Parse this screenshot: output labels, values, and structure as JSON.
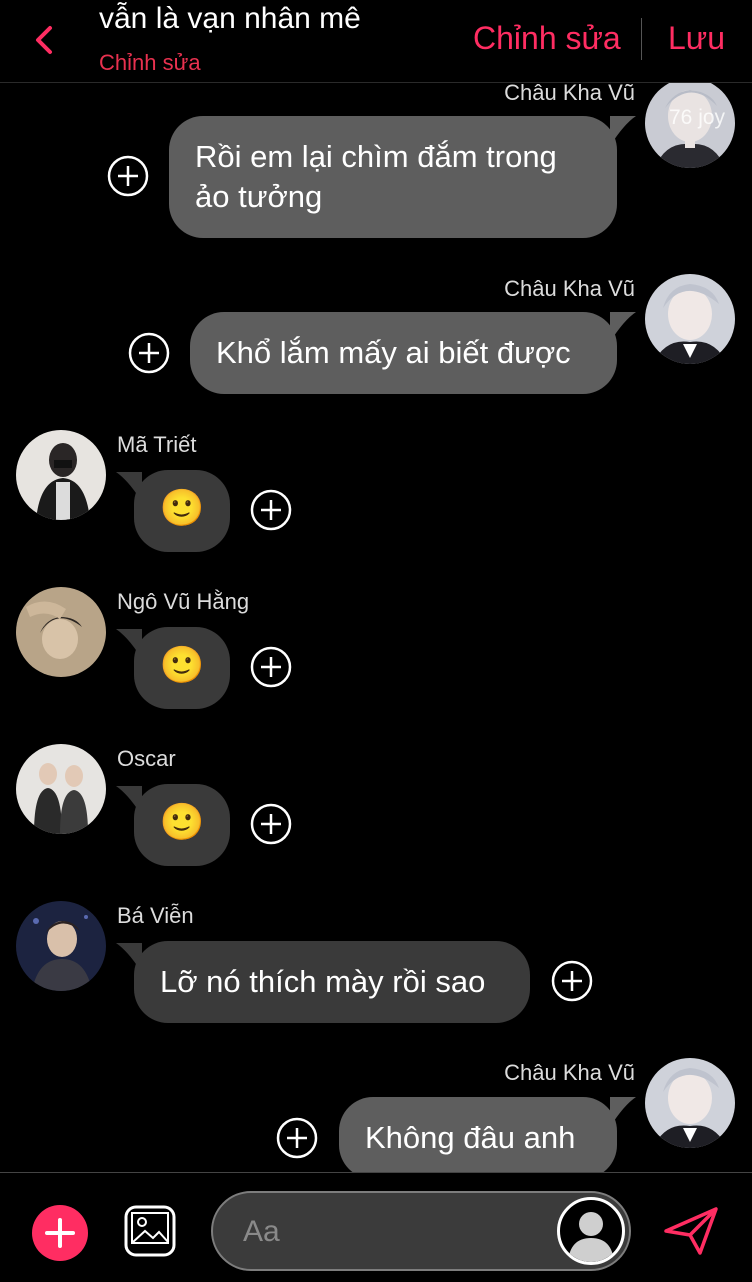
{
  "header": {
    "title": "vẫn là vạn nhân mê",
    "subtitle": "Chỉnh sửa",
    "edit_label": "Chỉnh sửa",
    "save_label": "Lưu"
  },
  "messages": [
    {
      "sender": "Châu Kha Vũ",
      "text": "Rồi em lại chìm đắm trong ảo tưởng",
      "line1": "Rồi em lại chìm đắm trong",
      "line2": "ảo tưởng",
      "avatar_watermark": "76 joy"
    },
    {
      "sender": "Châu Kha Vũ",
      "text": "Khổ lắm mấy ai biết được"
    },
    {
      "sender": "Mã Triết",
      "text": "🙂"
    },
    {
      "sender": "Ngô Vũ Hằng",
      "text": "🙂"
    },
    {
      "sender": "Oscar",
      "text": "🙂"
    },
    {
      "sender": "Bá Viễn",
      "text": "Lỡ nó thích mày rồi sao"
    },
    {
      "sender": "Châu Kha Vũ",
      "text": "Không đâu anh"
    }
  ],
  "composer": {
    "placeholder": "Aa",
    "accent": "#ff2d62"
  },
  "colors": {
    "accent": "#ff2d62",
    "bubble_right": "#5e5e5e",
    "bubble_left": "#3a3a3a",
    "background": "#000000"
  }
}
